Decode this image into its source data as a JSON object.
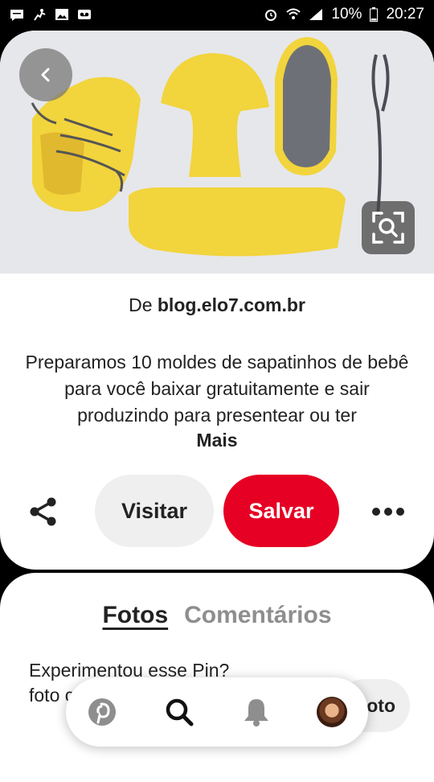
{
  "status_bar": {
    "battery": "10%",
    "time": "20:27"
  },
  "pin": {
    "source_prefix": "De",
    "source_domain": "blog.elo7.com.br",
    "description": "Preparamos 10 moldes de sapatinhos de bebê para você baixar gratuitamente e sair produzindo para presentear ou ter",
    "more_label": "Mais",
    "visit_label": "Visitar",
    "save_label": "Salvar",
    "accent_color": "#e60023"
  },
  "sheet": {
    "tabs": [
      "Fotos",
      "Comentários"
    ],
    "active_tab": "Fotos",
    "tried_text": "Experimentou esse Pin? foto como foi",
    "add_photo_label": "oto"
  },
  "bottom_nav": {
    "items": [
      "pinterest-icon",
      "search-icon",
      "bell-icon",
      "avatar"
    ]
  }
}
